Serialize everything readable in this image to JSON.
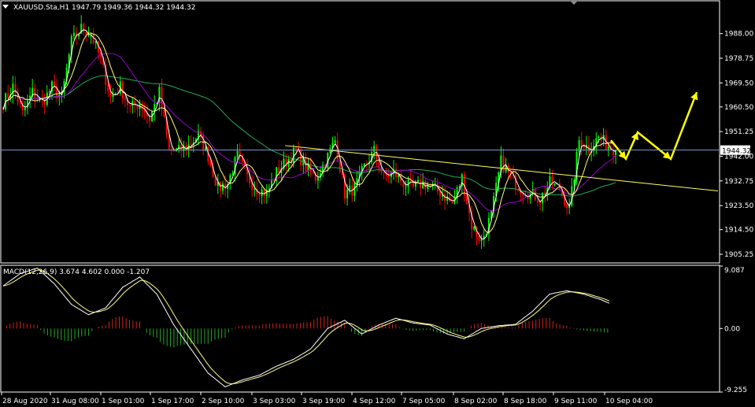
{
  "header": {
    "symbol_line": "XAUUSD.Sta,H1  1947.79 1949.36 1944.32 1944.32",
    "macd_line": "MACD(12,26,9) 3.674 4.602 0.000 -1.207"
  },
  "colors": {
    "background": "#000000",
    "bull": "#00ff00",
    "bear": "#ff0000",
    "ma_fast": "#ffffff",
    "ma_mid": "#ffff80",
    "ma_slow": "#9900cc",
    "ma_long": "#22aa55",
    "trendline": "#ffff66",
    "projection": "#ffff00",
    "price_line": "#7b9bd1",
    "macd_pos": "#cc2222",
    "macd_neg": "#22aa22",
    "axis": "#ffffff"
  },
  "chart_data": [
    {
      "type": "candlestick",
      "symbol": "XAUUSD.Sta",
      "timeframe": "H1",
      "ohlc_last": {
        "open": 1947.79,
        "high": 1949.36,
        "low": 1944.32,
        "close": 1944.32
      },
      "current_price": "1944.32",
      "ylim": [
        1902,
        2000
      ],
      "y_ticks": [
        "1988.00",
        "1978.75",
        "1969.50",
        "1960.50",
        "1951.25",
        "1942.00",
        "1932.75",
        "1923.50",
        "1914.50",
        "1905.25"
      ],
      "y_tick_values": [
        1988.0,
        1978.75,
        1969.5,
        1960.5,
        1951.25,
        1942.0,
        1932.75,
        1923.5,
        1914.5,
        1905.25
      ],
      "x_ticks": [
        "28 Aug 2020",
        "31 Aug 08:00",
        "1 Sep 01:00",
        "1 Sep 17:00",
        "2 Sep 10:00",
        "3 Sep 03:00",
        "3 Sep 19:00",
        "4 Sep 12:00",
        "7 Sep 05:00",
        "8 Sep 02:00",
        "8 Sep 18:00",
        "9 Sep 11:00",
        "10 Sep 04:00"
      ],
      "close_anchors": [
        [
          0,
          1962
        ],
        [
          4,
          1968
        ],
        [
          8,
          1958
        ],
        [
          12,
          1966
        ],
        [
          16,
          1962
        ],
        [
          20,
          1968
        ],
        [
          24,
          1964
        ],
        [
          28,
          1985
        ],
        [
          32,
          1990
        ],
        [
          36,
          1988
        ],
        [
          40,
          1978
        ],
        [
          44,
          1964
        ],
        [
          48,
          1968
        ],
        [
          52,
          1960
        ],
        [
          56,
          1962
        ],
        [
          60,
          1956
        ],
        [
          64,
          1966
        ],
        [
          68,
          1944
        ],
        [
          72,
          1944
        ],
        [
          76,
          1946
        ],
        [
          80,
          1950
        ],
        [
          84,
          1942
        ],
        [
          88,
          1930
        ],
        [
          92,
          1932
        ],
        [
          96,
          1942
        ],
        [
          100,
          1934
        ],
        [
          104,
          1930
        ],
        [
          108,
          1928
        ],
        [
          112,
          1936
        ],
        [
          116,
          1940
        ],
        [
          120,
          1944
        ],
        [
          124,
          1938
        ],
        [
          128,
          1934
        ],
        [
          132,
          1940
        ],
        [
          136,
          1948
        ],
        [
          140,
          1928
        ],
        [
          144,
          1930
        ],
        [
          148,
          1938
        ],
        [
          152,
          1944
        ],
        [
          156,
          1934
        ],
        [
          160,
          1936
        ],
        [
          164,
          1932
        ],
        [
          168,
          1930
        ],
        [
          172,
          1932
        ],
        [
          176,
          1930
        ],
        [
          180,
          1928
        ],
        [
          184,
          1924
        ],
        [
          188,
          1934
        ],
        [
          192,
          1916
        ],
        [
          196,
          1910
        ],
        [
          200,
          1920
        ],
        [
          204,
          1940
        ],
        [
          208,
          1934
        ],
        [
          212,
          1930
        ],
        [
          216,
          1928
        ],
        [
          220,
          1926
        ],
        [
          224,
          1932
        ],
        [
          228,
          1930
        ],
        [
          232,
          1922
        ],
        [
          236,
          1948
        ],
        [
          240,
          1945
        ],
        [
          244,
          1949
        ],
        [
          248,
          1946
        ],
        [
          251,
          1944.32
        ]
      ],
      "trendline": [
        [
          362,
          1946
        ],
        [
          912,
          1929
        ]
      ],
      "projection": [
        [
          776,
          1948
        ],
        [
          795,
          1941
        ],
        [
          810,
          1951
        ],
        [
          852,
          1941
        ],
        [
          885,
          1966
        ]
      ]
    },
    {
      "type": "macd",
      "params": "12,26,9",
      "values": {
        "main": 3.674,
        "signal": 4.602,
        "third": 0.0,
        "fourth": -1.207
      },
      "ylim": [
        -9.255,
        9.087
      ],
      "y_ticks": [
        "9.087",
        "0.00",
        "-9.255"
      ],
      "y_tick_values": [
        9.087,
        0.0,
        -9.255
      ],
      "macd_anchors": [
        [
          0,
          6.2
        ],
        [
          10,
          8.0
        ],
        [
          20,
          8.8
        ],
        [
          30,
          6.5
        ],
        [
          40,
          3.5
        ],
        [
          50,
          2.0
        ],
        [
          60,
          3.0
        ],
        [
          70,
          6.0
        ],
        [
          80,
          7.5
        ],
        [
          90,
          5.0
        ],
        [
          100,
          0.5
        ],
        [
          110,
          -3.0
        ],
        [
          120,
          -6.5
        ],
        [
          130,
          -8.5
        ],
        [
          140,
          -7.5
        ],
        [
          150,
          -6.8
        ],
        [
          160,
          -5.5
        ],
        [
          170,
          -4.5
        ],
        [
          180,
          -3.0
        ],
        [
          190,
          0.0
        ],
        [
          200,
          1.2
        ],
        [
          210,
          -0.8
        ],
        [
          220,
          0.5
        ],
        [
          230,
          1.5
        ],
        [
          240,
          0.8
        ],
        [
          250,
          0.5
        ],
        [
          260,
          -0.8
        ],
        [
          270,
          -1.5
        ],
        [
          280,
          0.0
        ],
        [
          290,
          0.4
        ],
        [
          300,
          0.6
        ],
        [
          310,
          2.5
        ],
        [
          320,
          5.0
        ],
        [
          330,
          5.5
        ],
        [
          340,
          5.0
        ],
        [
          350,
          4.2
        ],
        [
          355,
          3.674
        ]
      ]
    }
  ]
}
